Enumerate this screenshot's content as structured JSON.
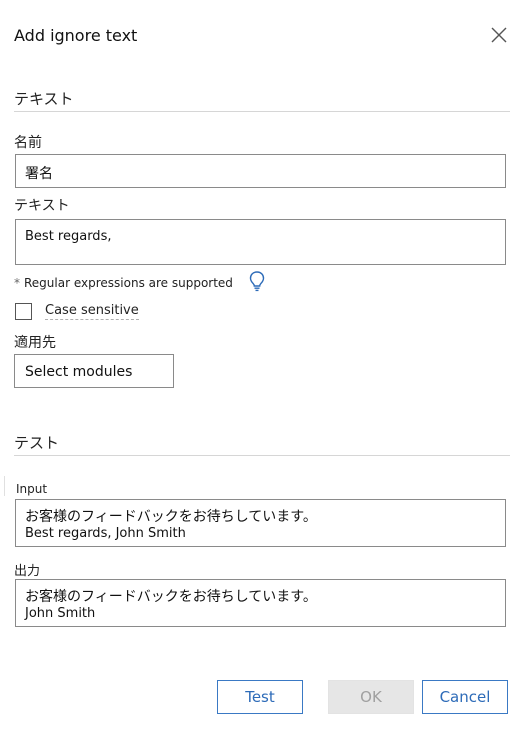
{
  "dialog": {
    "title": "Add ignore text"
  },
  "text_section": {
    "heading": "テキスト",
    "name_label": "名前",
    "name_value": "署名",
    "text_label": "テキスト",
    "text_value": "Best regards,",
    "hint_star": "*",
    "hint": "Regular expressions are supported",
    "case_sensitive_label": "Case sensitive",
    "case_sensitive_checked": false,
    "applies_to_label": "適用先",
    "applies_to_value": "Select modules"
  },
  "test_section": {
    "heading": "テスト",
    "input_label": "Input",
    "input_line1": "お客様のフィードバックをお待ちしています。",
    "input_line2": "Best regards, John Smith",
    "output_label": "出力",
    "output_line1": "お客様のフィードバックをお待ちしています。",
    "output_line2": "John Smith"
  },
  "buttons": {
    "test": "Test",
    "ok": "OK",
    "cancel": "Cancel"
  },
  "colors": {
    "accent": "#2d6bb8",
    "disabled_bg": "#e6e6e6",
    "border": "#8a8a8a"
  }
}
